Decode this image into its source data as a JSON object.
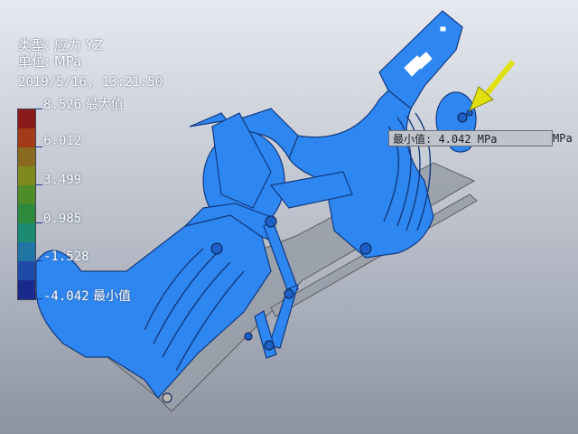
{
  "legend": {
    "type_line": "类型: 应力 YZ",
    "unit_line": "单位: MPa",
    "datetime": "2019/5/16, 13:21:50",
    "ticks": [
      {
        "value": "8.526",
        "suffix": " 最大值"
      },
      {
        "value": "6.012",
        "suffix": ""
      },
      {
        "value": "3.499",
        "suffix": ""
      },
      {
        "value": "0.985",
        "suffix": ""
      },
      {
        "value": "-1.528",
        "suffix": ""
      },
      {
        "value": "-4.042",
        "suffix": " 最小值"
      }
    ],
    "band_colors": [
      "#8b1a1a",
      "#a33a1a",
      "#8a6a1e",
      "#7f8a1e",
      "#4e8c2a",
      "#2d8a3c",
      "#1d8a72",
      "#2075a4",
      "#1f4aa8",
      "#1a2a8c"
    ]
  },
  "probe": {
    "label": "最小值:  4.042 MPa",
    "ghost": "MPa"
  },
  "colors": {
    "model_blue": "#2e86f0",
    "model_edge": "#123a80",
    "arrow": "#e0e010"
  }
}
